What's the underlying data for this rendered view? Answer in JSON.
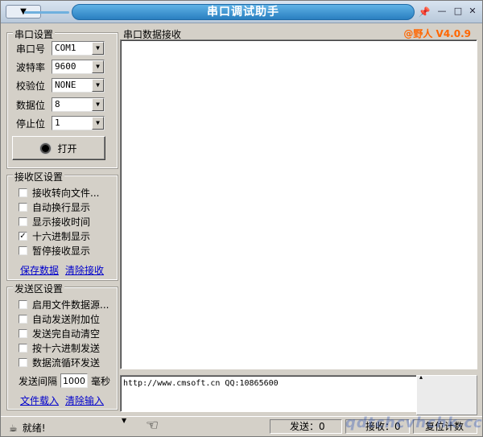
{
  "titlebar": {
    "sysmenu_label": "▼",
    "title": "串口调试助手",
    "pin_icon": "pin-icon",
    "min_label": "—",
    "max_label": "□",
    "close_label": "✕"
  },
  "serial_settings": {
    "title": "串口设置",
    "port_label": "串口号",
    "port_value": "COM1",
    "baud_label": "波特率",
    "baud_value": "9600",
    "parity_label": "校验位",
    "parity_value": "NONE",
    "databits_label": "数据位",
    "databits_value": "8",
    "stopbits_label": "停止位",
    "stopbits_value": "1",
    "open_button": "打开"
  },
  "receive_settings": {
    "title": "接收区设置",
    "options": [
      {
        "label": "接收转向文件...",
        "checked": false
      },
      {
        "label": "自动换行显示",
        "checked": false
      },
      {
        "label": "显示接收时间",
        "checked": false
      },
      {
        "label": "十六进制显示",
        "checked": true
      },
      {
        "label": "暂停接收显示",
        "checked": false
      }
    ],
    "save_link": "保存数据",
    "clear_link": "清除接收"
  },
  "send_settings": {
    "title": "发送区设置",
    "options": [
      {
        "label": "启用文件数据源...",
        "checked": false
      },
      {
        "label": "自动发送附加位",
        "checked": false
      },
      {
        "label": "发送完自动清空",
        "checked": false
      },
      {
        "label": "按十六进制发送",
        "checked": false
      },
      {
        "label": "数据流循环发送",
        "checked": false
      }
    ],
    "interval_label": "发送间隔",
    "interval_value": "1000",
    "interval_unit": "毫秒",
    "load_link": "文件载入",
    "clear_link": "清除输入"
  },
  "receive_area": {
    "label": "串口数据接收",
    "version": "@野人 V4.0.9"
  },
  "send_area": {
    "text": "http://www.cmsoft.cn QQ:10865600"
  },
  "statusbar": {
    "ready": "就绪!",
    "send_count": "发送：0",
    "recv_count": "接收：0",
    "reset_label": "复位计数"
  },
  "watermark": "qdtchcvhchk.cc"
}
